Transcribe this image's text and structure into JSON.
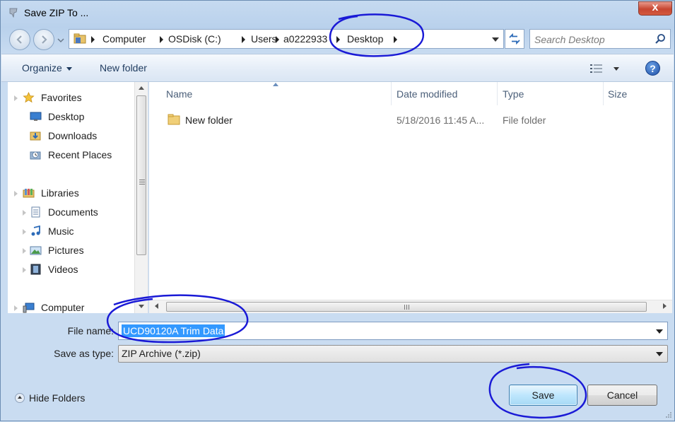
{
  "window": {
    "title": "Save ZIP To ...",
    "close_label": "x"
  },
  "address": {
    "crumbs": [
      "Computer",
      "OSDisk (C:)",
      "Users",
      "a0222933",
      "Desktop"
    ]
  },
  "search": {
    "placeholder": "Search Desktop"
  },
  "toolbar": {
    "organize_label": "Organize",
    "new_folder_label": "New folder",
    "help_label": "?"
  },
  "nav": {
    "favorites": {
      "label": "Favorites",
      "items": [
        "Desktop",
        "Downloads",
        "Recent Places"
      ]
    },
    "libraries": {
      "label": "Libraries",
      "items": [
        "Documents",
        "Music",
        "Pictures",
        "Videos"
      ]
    },
    "computer": {
      "label": "Computer"
    }
  },
  "list": {
    "columns": [
      "Name",
      "Date modified",
      "Type",
      "Size"
    ],
    "rows": [
      {
        "name": "New folder",
        "date": "5/18/2016 11:45 A...",
        "type": "File folder",
        "size": ""
      }
    ]
  },
  "form": {
    "filename_label": "File name:",
    "filename_value": "UCD90120A Trim Data",
    "savetype_label": "Save as type:",
    "savetype_value": "ZIP Archive (*.zip)"
  },
  "footer": {
    "hide_folders_label": "Hide Folders",
    "save_label": "Save",
    "cancel_label": "Cancel"
  },
  "colors": {
    "accent": "#3399ff",
    "annotation": "#1a1ad6",
    "chrome": "#c6daf0"
  }
}
